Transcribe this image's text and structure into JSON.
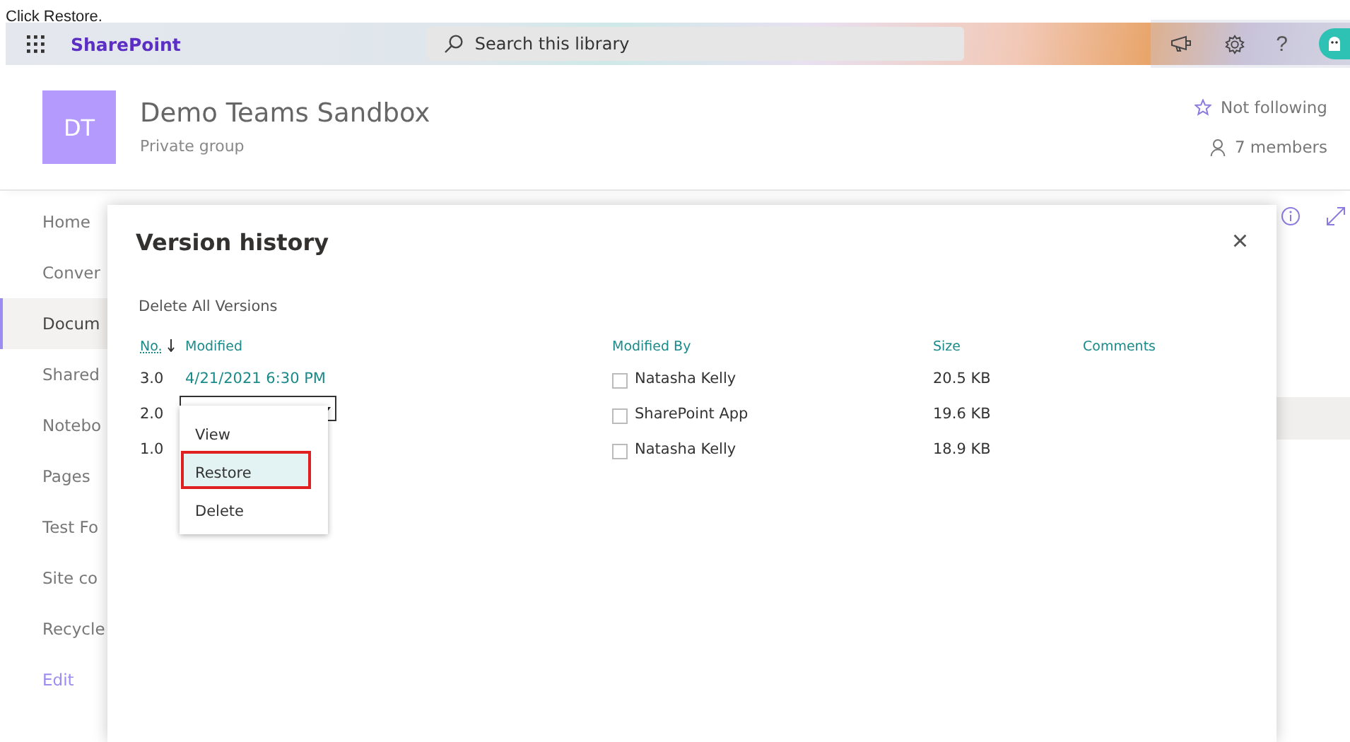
{
  "caption": "Click Restore.",
  "topbar": {
    "app_name": "SharePoint",
    "search": {
      "placeholder": "Search this library"
    },
    "help": "?"
  },
  "site": {
    "logo": "DT",
    "title": "Demo Teams Sandbox",
    "subtitle": "Private group",
    "follow": "Not following",
    "members": "7 members"
  },
  "nav": [
    {
      "label": "Home",
      "kind": "page",
      "selected": false
    },
    {
      "label": "Conver",
      "kind": "page",
      "selected": false
    },
    {
      "label": "Docum",
      "kind": "page",
      "selected": true
    },
    {
      "label": "Shared",
      "kind": "page",
      "selected": false
    },
    {
      "label": "Notebo",
      "kind": "page",
      "selected": false
    },
    {
      "label": "Pages",
      "kind": "page",
      "selected": false
    },
    {
      "label": "Test Fo",
      "kind": "page",
      "selected": false
    },
    {
      "label": "Site co",
      "kind": "page",
      "selected": false
    },
    {
      "label": "Recycle",
      "kind": "page",
      "selected": false
    },
    {
      "label": "Edit",
      "kind": "link",
      "selected": false
    }
  ],
  "dialog": {
    "title": "Version history",
    "close": "×",
    "delete_all": "Delete All Versions",
    "columns": [
      {
        "label": "No.",
        "sorted": true
      },
      {
        "label": "Modified",
        "sorted": false
      },
      {
        "label": "Modified By",
        "sorted": false
      },
      {
        "label": "Size",
        "sorted": false
      },
      {
        "label": "Comments",
        "sorted": false
      }
    ],
    "rows": [
      {
        "no": "3.0",
        "modified": "4/21/2021 6:30 PM",
        "menu_open": false,
        "modified_by": "Natasha Kelly",
        "checked": false,
        "size": "20.5 KB"
      },
      {
        "no": "2.0",
        "menu_open": true,
        "modified_by": "SharePoint App",
        "checked": false,
        "size": "19.6 KB"
      },
      {
        "no": "1.0",
        "menu_open": false,
        "modified_by": "Natasha Kelly",
        "checked": false,
        "size": "18.9 KB"
      }
    ],
    "menu": [
      {
        "label": "View",
        "selected": false,
        "callout": false
      },
      {
        "label": "Restore",
        "selected": true,
        "callout": true
      },
      {
        "label": "Delete",
        "selected": false,
        "callout": false
      }
    ]
  }
}
